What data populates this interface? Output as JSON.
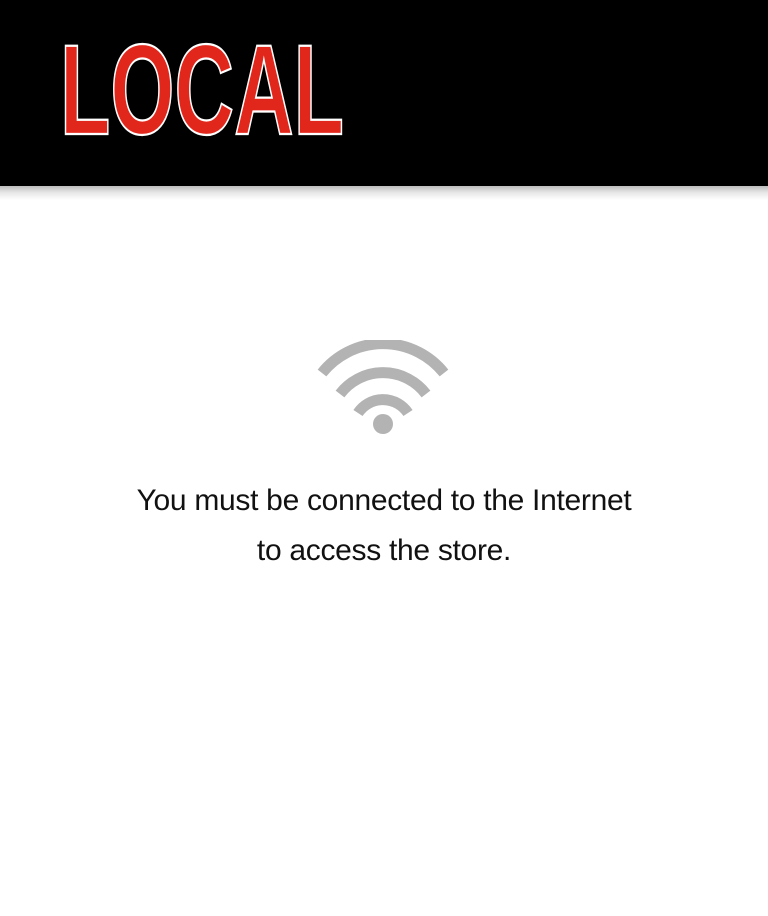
{
  "header": {
    "logo_text": "LOCAL",
    "logo_color": "#e1261c",
    "background": "#000000"
  },
  "offline": {
    "icon": "wifi-icon",
    "icon_color": "#b3b3b3",
    "message_line1": "You must be connected to the Internet",
    "message_line2": "to access the store."
  }
}
